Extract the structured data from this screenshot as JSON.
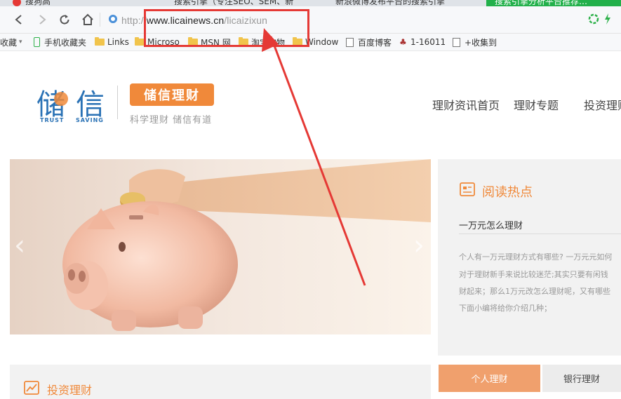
{
  "browser": {
    "tabs": [
      {
        "label": "搜狗高"
      },
      {
        "label": "搜索引擎（专注SEO、SEM、新"
      },
      {
        "label": "新浪微博发布平台的搜索引擎"
      },
      {
        "label": "搜索引擎分析平台推荐…"
      }
    ],
    "url": {
      "scheme": "http://",
      "domain": "www.licainews.cn",
      "path": "/licaizixun"
    },
    "bookmarks": [
      {
        "label": "收藏",
        "icon": "chevron-down-icon"
      },
      {
        "label": "手机收藏夹",
        "icon": "phone-icon"
      },
      {
        "label": "Links",
        "icon": "folder-icon"
      },
      {
        "label": "Microso",
        "icon": "folder-icon"
      },
      {
        "label": "MSN 网",
        "icon": "folder-icon"
      },
      {
        "label": "淘宝购物",
        "icon": "folder-icon"
      },
      {
        "label": "Window",
        "icon": "folder-icon"
      },
      {
        "label": "百度博客",
        "icon": "page-icon"
      },
      {
        "label": "1-16011",
        "icon": "figure-icon"
      },
      {
        "label": "+收集到",
        "icon": "page-icon"
      }
    ]
  },
  "site": {
    "logo": {
      "char1": "储",
      "char2": "信",
      "sub1": "TRUST",
      "sub2": "SAVING",
      "badge": "储信理财",
      "slogan": "科学理财 储信有道"
    },
    "nav": [
      "理财资讯首页",
      "理财专题",
      "投资理财"
    ]
  },
  "sidebar": {
    "title": "阅读热点",
    "item_title": "一万元怎么理财",
    "excerpt_lines": [
      "个人有一万元理财方式有哪些? 一万元元如何",
      "对于理财新手来说比较迷茫;其实只要有闲钱",
      "财起来；那么1万元改怎么理财呢，又有哪些",
      "下面小编将给你介绍几种；"
    ]
  },
  "bottom": {
    "invest_title": "投资理财",
    "tab_personal": "个人理财",
    "tab_bank": "银行理财"
  },
  "colors": {
    "accent": "#f0893a",
    "brand_blue": "#2a72b5",
    "annotation_red": "#e53935"
  }
}
